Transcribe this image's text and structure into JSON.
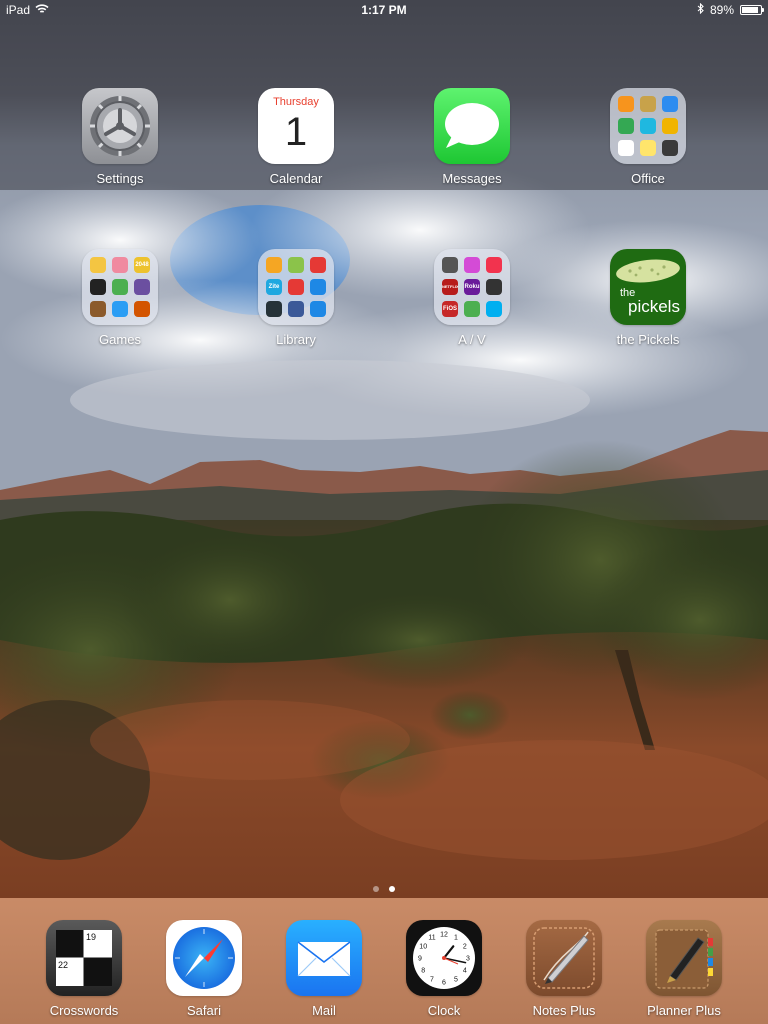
{
  "status_bar": {
    "device": "iPad",
    "time": "1:17 PM",
    "battery_percent": "89%",
    "battery_level": 0.89
  },
  "home": {
    "row1": [
      {
        "label": "Settings",
        "icon": "settings-gear-icon"
      },
      {
        "label": "Calendar",
        "icon": "calendar-icon",
        "day_name": "Thursday",
        "day_number": "1"
      },
      {
        "label": "Messages",
        "icon": "messages-bubble-icon"
      },
      {
        "label": "Office",
        "icon": "folder-icon"
      }
    ],
    "row2": [
      {
        "label": "Games",
        "icon": "folder-icon"
      },
      {
        "label": "Library",
        "icon": "folder-icon"
      },
      {
        "label": "A / V",
        "icon": "folder-icon"
      },
      {
        "label": "the Pickels",
        "icon": "pickle-icon",
        "logo_text_1": "the",
        "logo_text_2": "pickels"
      }
    ],
    "page_count": 2,
    "current_page": 2
  },
  "folder_minis": {
    "office": [
      {
        "color": "#f7941d"
      },
      {
        "color": "#c8a24a"
      },
      {
        "color": "#2d8cf0"
      },
      {
        "color": "#34a853"
      },
      {
        "color": "#1fb8e0"
      },
      {
        "color": "#f0b400"
      },
      {
        "color": "#ffffff"
      },
      {
        "color": "#ffe56b"
      },
      {
        "color": "#3a3a3a"
      }
    ],
    "games": [
      {
        "color": "#f4c542"
      },
      {
        "color": "#f08aa0"
      },
      {
        "color": "#edc22e",
        "text": "2048"
      },
      {
        "color": "#222222"
      },
      {
        "color": "#4caf50"
      },
      {
        "color": "#6b4fa0"
      },
      {
        "color": "#8b5a2b"
      },
      {
        "color": "#2a9df4"
      },
      {
        "color": "#d35400"
      }
    ],
    "library": [
      {
        "color": "#f5a623"
      },
      {
        "color": "#8bc34a"
      },
      {
        "color": "#e53935"
      },
      {
        "color": "#1ea8e0",
        "text": "Zite"
      },
      {
        "color": "#e53935"
      },
      {
        "color": "#1e88e5"
      },
      {
        "color": "#263238"
      },
      {
        "color": "#3b5998"
      },
      {
        "color": "#1e88e5"
      }
    ],
    "av": [
      {
        "color": "#555555"
      },
      {
        "color": "#d44bd6"
      },
      {
        "color": "#f2334e"
      },
      {
        "color": "#b71c1c",
        "text": "NETFLIX"
      },
      {
        "color": "#6a1b9a",
        "text": "Roku"
      },
      {
        "color": "#333333"
      },
      {
        "color": "#c62828",
        "text": "FiOS"
      },
      {
        "color": "#4caf50"
      },
      {
        "color": "#00aff0"
      }
    ]
  },
  "dock": [
    {
      "label": "Crosswords",
      "icon": "crossword-grid-icon",
      "clue_a": "19",
      "clue_b": "22"
    },
    {
      "label": "Safari",
      "icon": "safari-compass-icon"
    },
    {
      "label": "Mail",
      "icon": "mail-envelope-icon"
    },
    {
      "label": "Clock",
      "icon": "clock-icon",
      "hour": 1,
      "minute": 17
    },
    {
      "label": "Notes Plus",
      "icon": "notes-plus-pen-icon"
    },
    {
      "label": "Planner Plus",
      "icon": "planner-plus-pen-icon"
    }
  ]
}
